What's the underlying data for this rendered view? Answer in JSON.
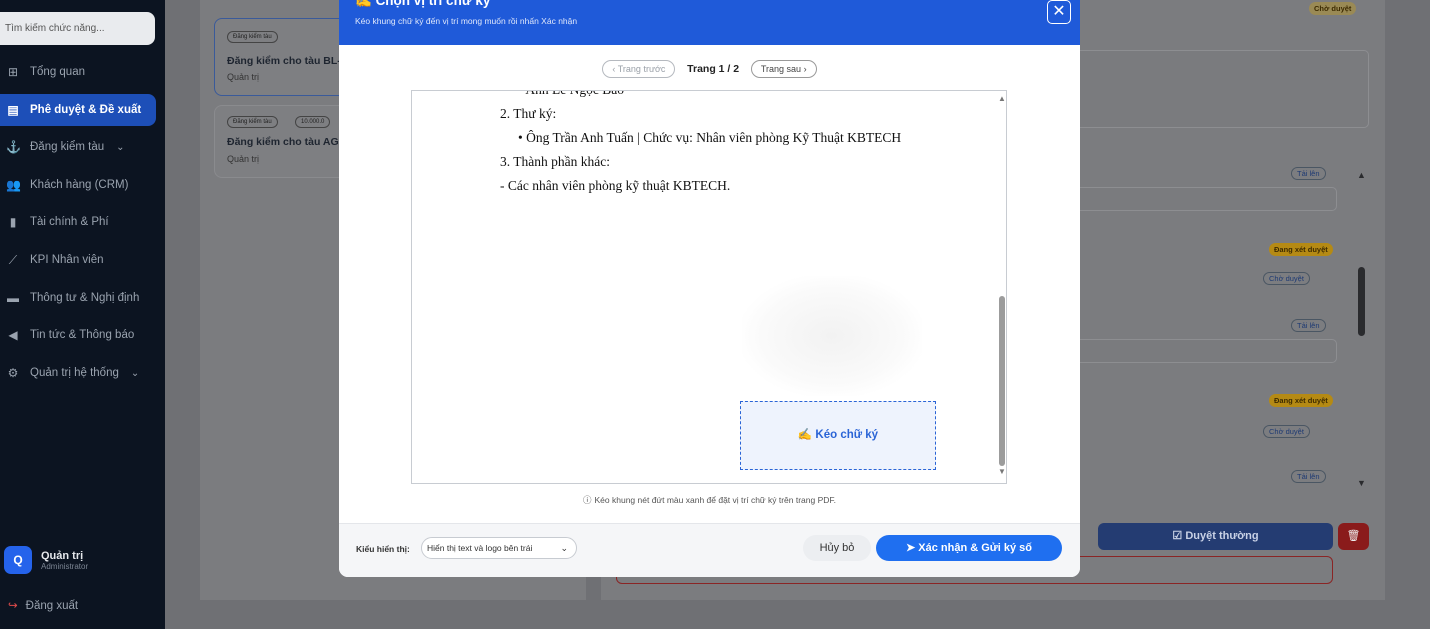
{
  "sidebar": {
    "search_placeholder": "Tìm kiếm chức năng...",
    "items": [
      {
        "label": "Tổng quan",
        "icon": "grid-icon"
      },
      {
        "label": "Phê duyệt & Đề xuất",
        "icon": "file-icon",
        "active": true
      },
      {
        "label": "Đăng kiểm tàu",
        "icon": "anchor-icon",
        "chevron": true
      },
      {
        "label": "Khách hàng (CRM)",
        "icon": "users-icon"
      },
      {
        "label": "Tài chính & Phí",
        "icon": "receipt-icon"
      },
      {
        "label": "KPI Nhân viên",
        "icon": "chart-line-icon"
      },
      {
        "label": "Thông tư & Nghị định",
        "icon": "folder-icon"
      },
      {
        "label": "Tin tức & Thông báo",
        "icon": "megaphone-icon"
      },
      {
        "label": "Quản trị hệ thống",
        "icon": "user-cog-icon",
        "chevron": true
      }
    ],
    "user": {
      "initial": "Q",
      "name": "Quản trị",
      "role": "Administrator"
    },
    "logout_label": "Đăng xuất"
  },
  "background": {
    "cards": [
      {
        "tag": "Đăng kiểm tàu",
        "title": "Đăng kiểm cho tàu BL-",
        "owner": "Quản trị"
      },
      {
        "tag": "Đăng kiểm tàu",
        "amount": "10.000.0",
        "title": "Đăng kiểm cho tàu AG-",
        "owner": "Quản trị"
      }
    ],
    "status_top": "Chờ duyệt",
    "status_reviewing": "Đang xét duyệt",
    "status_pending": "Chờ duyệt",
    "upload_label": "Tải lên",
    "approve_label": "Duyệt thường"
  },
  "modal": {
    "title": "Chọn vị trí chữ ký",
    "subtitle": "Kéo khung chữ ký đến vị trí mong muốn rồi nhấn Xác nhận",
    "pager": {
      "prev": "Trang trước",
      "label": "Trang 1 / 2",
      "next": "Trang sau"
    },
    "document_lines": [
      "•   Anh   Lê Ngọc Bảo",
      "2. Thư ký:",
      "•   Ông   Trần Anh Tuấn | Chức vụ: Nhân viên phòng Kỹ Thuật KBTECH",
      "3. Thành phần khác:",
      "- Các nhân viên phòng kỹ thuật KBTECH."
    ],
    "signature_box_label": "Kéo chữ ký",
    "hint": "Kéo khung nét đứt màu xanh để đặt vị trí chữ ký trên trang PDF.",
    "display_mode_label": "Kiểu hiển thị:",
    "display_mode_value": "Hiển thị text và logo bên trái",
    "cancel_label": "Hủy bỏ",
    "confirm_label": "Xác nhận & Gửi ký số"
  }
}
